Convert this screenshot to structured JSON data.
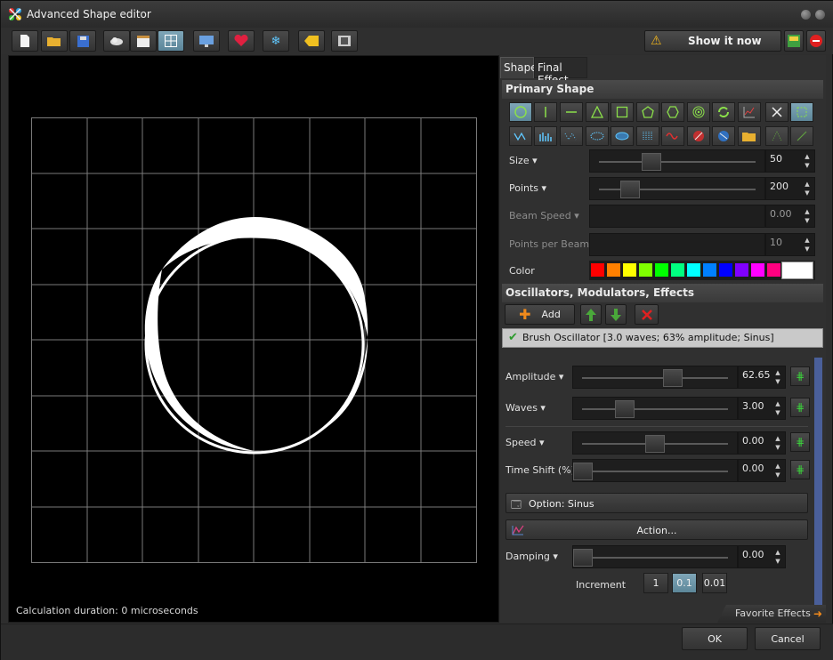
{
  "window": {
    "title": "Advanced Shape editor"
  },
  "toolbar": {
    "icons": [
      "new-icon",
      "open-folder-icon",
      "save-icon",
      "cloud-icon",
      "clapper-icon",
      "grid-icon",
      "monitor-icon",
      "heart-icon",
      "snowflake-icon",
      "tag-icon",
      "film-icon"
    ],
    "show_label": "Show it now"
  },
  "canvas": {
    "calc_text": "Calculation duration: 0 microseconds"
  },
  "tabs": {
    "shape": "Shape",
    "final_effect": "Final Effect"
  },
  "primary_shape": {
    "header": "Primary Shape",
    "rows": [
      {
        "label": "Size",
        "value": "50",
        "level": 0.4,
        "disabled": false
      },
      {
        "label": "Points",
        "value": "200",
        "level": 0.2,
        "disabled": false
      },
      {
        "label": "Beam Speed",
        "value": "0.00",
        "level": null,
        "disabled": true
      },
      {
        "label": "Points per Beam",
        "value": "10",
        "level": null,
        "disabled": true
      }
    ],
    "color_label": "Color",
    "colors": [
      "#ff0000",
      "#ff8000",
      "#ffff00",
      "#80ff00",
      "#00ff00",
      "#00ff80",
      "#00ffff",
      "#0080ff",
      "#0000ff",
      "#8000ff",
      "#ff00ff",
      "#ff0080"
    ],
    "selected_color": "#ffffff"
  },
  "oscillators": {
    "header": "Oscillators, Modulators, Effects",
    "add_label": "Add",
    "item": "Brush Oscillator [3.0 waves; 63% amplitude; Sinus]",
    "params": [
      {
        "label": "Amplitude",
        "value": "62.65",
        "level": 0.6
      },
      {
        "label": "Waves",
        "value": "3.00",
        "level": 0.3
      },
      {
        "label": "Speed",
        "value": "0.00",
        "level": 0.5
      },
      {
        "label": "Time Shift (%)",
        "value": "0.00",
        "level": 0.0
      }
    ],
    "option_label": "Option: Sinus",
    "action_label": "Action...",
    "damping": {
      "label": "Damping",
      "value": "0.00",
      "level": 0.0
    },
    "increment": {
      "label": "Increment",
      "options": [
        "1",
        "0.1",
        "0.01"
      ],
      "selected": "0.1"
    }
  },
  "favorites_label": "Favorite Effects",
  "dialog": {
    "ok": "OK",
    "cancel": "Cancel"
  }
}
